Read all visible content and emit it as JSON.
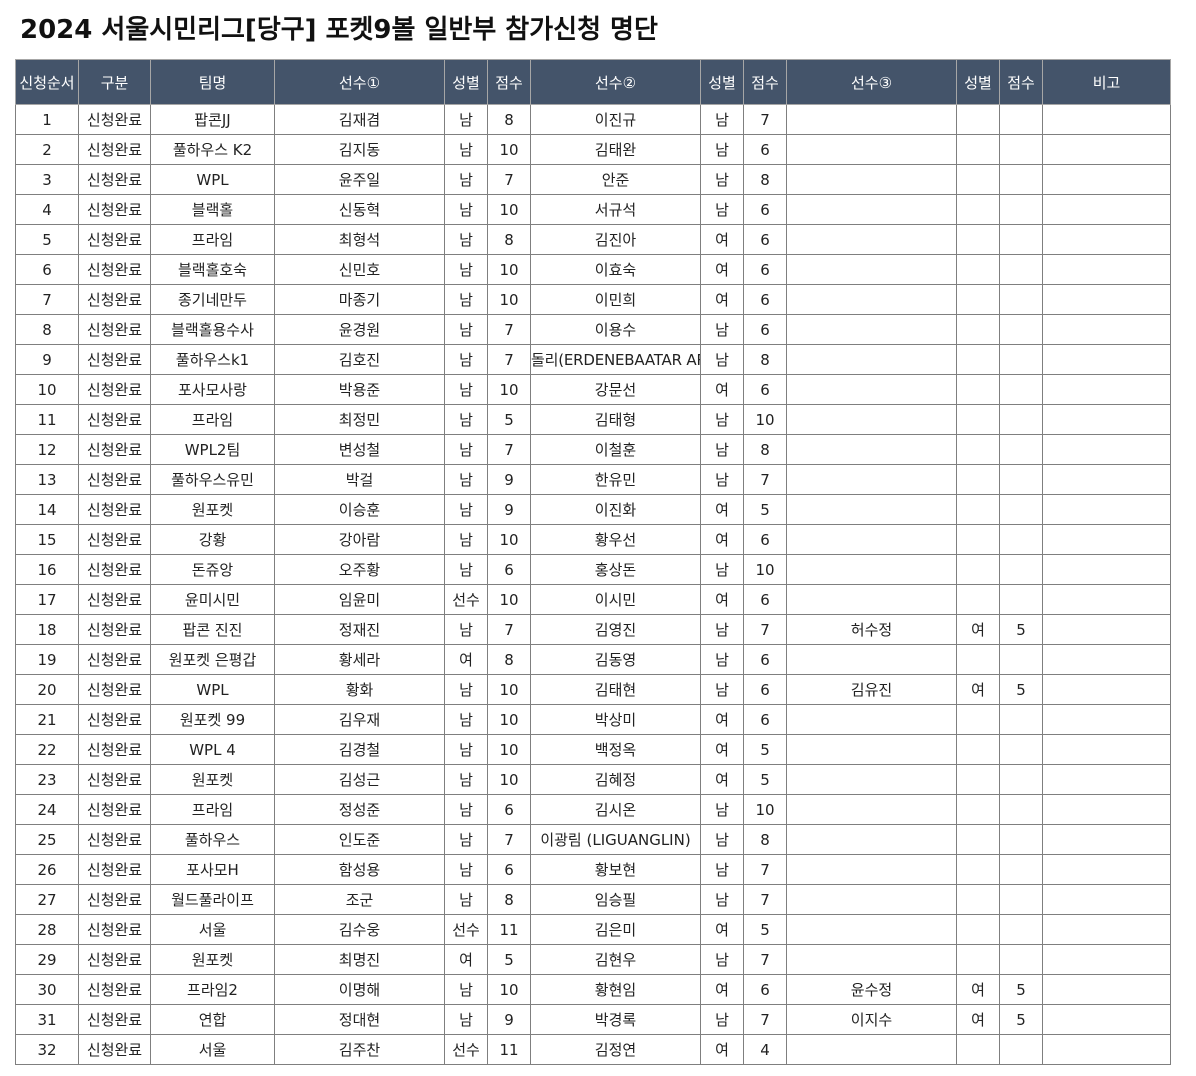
{
  "title": "2024 서울시민리그[당구] 포켓9볼 일반부 참가신청 명단",
  "colors": {
    "header_bg": "#44546a",
    "header_text": "#ffffff",
    "status_text": "#1a1aa8"
  },
  "columns": [
    "신청순서",
    "구분",
    "팀명",
    "선수①",
    "성별",
    "점수",
    "선수②",
    "성별",
    "점수",
    "선수③",
    "성별",
    "점수",
    "비고"
  ],
  "rows": [
    [
      "1",
      "신청완료",
      "팝콘JJ",
      "김재겸",
      "남",
      "8",
      "이진규",
      "남",
      "7",
      "",
      "",
      "",
      ""
    ],
    [
      "2",
      "신청완료",
      "풀하우스 K2",
      "김지동",
      "남",
      "10",
      "김태완",
      "남",
      "6",
      "",
      "",
      "",
      ""
    ],
    [
      "3",
      "신청완료",
      "WPL",
      "윤주일",
      "남",
      "7",
      "안준",
      "남",
      "8",
      "",
      "",
      "",
      ""
    ],
    [
      "4",
      "신청완료",
      "블랙홀",
      "신동혁",
      "남",
      "10",
      "서규석",
      "남",
      "6",
      "",
      "",
      "",
      ""
    ],
    [
      "5",
      "신청완료",
      "프라임",
      "최형석",
      "남",
      "8",
      "김진아",
      "여",
      "6",
      "",
      "",
      "",
      ""
    ],
    [
      "6",
      "신청완료",
      "블랙홀호숙",
      "신민호",
      "남",
      "10",
      "이효숙",
      "여",
      "6",
      "",
      "",
      "",
      ""
    ],
    [
      "7",
      "신청완료",
      "종기네만두",
      "마종기",
      "남",
      "10",
      "이민희",
      "여",
      "6",
      "",
      "",
      "",
      ""
    ],
    [
      "8",
      "신청완료",
      "블랙홀용수사",
      "윤경원",
      "남",
      "7",
      "이용수",
      "남",
      "6",
      "",
      "",
      "",
      ""
    ],
    [
      "9",
      "신청완료",
      "풀하우스k1",
      "김호진",
      "남",
      "7",
      "돌리(ERDENEBAATAR ARIUNDUL)",
      "남",
      "8",
      "",
      "",
      "",
      ""
    ],
    [
      "10",
      "신청완료",
      "포사모사랑",
      "박용준",
      "남",
      "10",
      "강문선",
      "여",
      "6",
      "",
      "",
      "",
      ""
    ],
    [
      "11",
      "신청완료",
      "프라임",
      "최정민",
      "남",
      "5",
      "김태형",
      "남",
      "10",
      "",
      "",
      "",
      ""
    ],
    [
      "12",
      "신청완료",
      "WPL2팀",
      "변성철",
      "남",
      "7",
      "이철훈",
      "남",
      "8",
      "",
      "",
      "",
      ""
    ],
    [
      "13",
      "신청완료",
      "풀하우스유민",
      "박걸",
      "남",
      "9",
      "한유민",
      "남",
      "7",
      "",
      "",
      "",
      ""
    ],
    [
      "14",
      "신청완료",
      "원포켓",
      "이승훈",
      "남",
      "9",
      "이진화",
      "여",
      "5",
      "",
      "",
      "",
      ""
    ],
    [
      "15",
      "신청완료",
      "강황",
      "강아람",
      "남",
      "10",
      "황우선",
      "여",
      "6",
      "",
      "",
      "",
      ""
    ],
    [
      "16",
      "신청완료",
      "돈쥬앙",
      "오주황",
      "남",
      "6",
      "홍상돈",
      "남",
      "10",
      "",
      "",
      "",
      ""
    ],
    [
      "17",
      "신청완료",
      "윤미시민",
      "임윤미",
      "선수",
      "10",
      "이시민",
      "여",
      "6",
      "",
      "",
      "",
      ""
    ],
    [
      "18",
      "신청완료",
      "팝콘 진진",
      "정재진",
      "남",
      "7",
      "김영진",
      "남",
      "7",
      "허수정",
      "여",
      "5",
      ""
    ],
    [
      "19",
      "신청완료",
      "원포켓 은평갑",
      "황세라",
      "여",
      "8",
      "김동영",
      "남",
      "6",
      "",
      "",
      "",
      ""
    ],
    [
      "20",
      "신청완료",
      "WPL",
      "황화",
      "남",
      "10",
      "김태현",
      "남",
      "6",
      "김유진",
      "여",
      "5",
      ""
    ],
    [
      "21",
      "신청완료",
      "원포켓 99",
      "김우재",
      "남",
      "10",
      "박상미",
      "여",
      "6",
      "",
      "",
      "",
      ""
    ],
    [
      "22",
      "신청완료",
      "WPL 4",
      "김경철",
      "남",
      "10",
      "백정옥",
      "여",
      "5",
      "",
      "",
      "",
      ""
    ],
    [
      "23",
      "신청완료",
      "원포켓",
      "김성근",
      "남",
      "10",
      "김혜정",
      "여",
      "5",
      "",
      "",
      "",
      ""
    ],
    [
      "24",
      "신청완료",
      "프라임",
      "정성준",
      "남",
      "6",
      "김시온",
      "남",
      "10",
      "",
      "",
      "",
      ""
    ],
    [
      "25",
      "신청완료",
      "풀하우스",
      "인도준",
      "남",
      "7",
      "이광림 (LIGUANGLIN)",
      "남",
      "8",
      "",
      "",
      "",
      ""
    ],
    [
      "26",
      "신청완료",
      "포사모H",
      "함성용",
      "남",
      "6",
      "황보현",
      "남",
      "7",
      "",
      "",
      "",
      ""
    ],
    [
      "27",
      "신청완료",
      "월드풀라이프",
      "조군",
      "남",
      "8",
      "임승필",
      "남",
      "7",
      "",
      "",
      "",
      ""
    ],
    [
      "28",
      "신청완료",
      "서울",
      "김수웅",
      "선수",
      "11",
      "김은미",
      "여",
      "5",
      "",
      "",
      "",
      ""
    ],
    [
      "29",
      "신청완료",
      "원포켓",
      "최명진",
      "여",
      "5",
      "김현우",
      "남",
      "7",
      "",
      "",
      "",
      ""
    ],
    [
      "30",
      "신청완료",
      "프라임2",
      "이명해",
      "남",
      "10",
      "황현임",
      "여",
      "6",
      "윤수정",
      "여",
      "5",
      ""
    ],
    [
      "31",
      "신청완료",
      "연합",
      "정대현",
      "남",
      "9",
      "박경록",
      "남",
      "7",
      "이지수",
      "여",
      "5",
      ""
    ],
    [
      "32",
      "신청완료",
      "서울",
      "김주찬",
      "선수",
      "11",
      "김정연",
      "여",
      "4",
      "",
      "",
      "",
      ""
    ]
  ]
}
